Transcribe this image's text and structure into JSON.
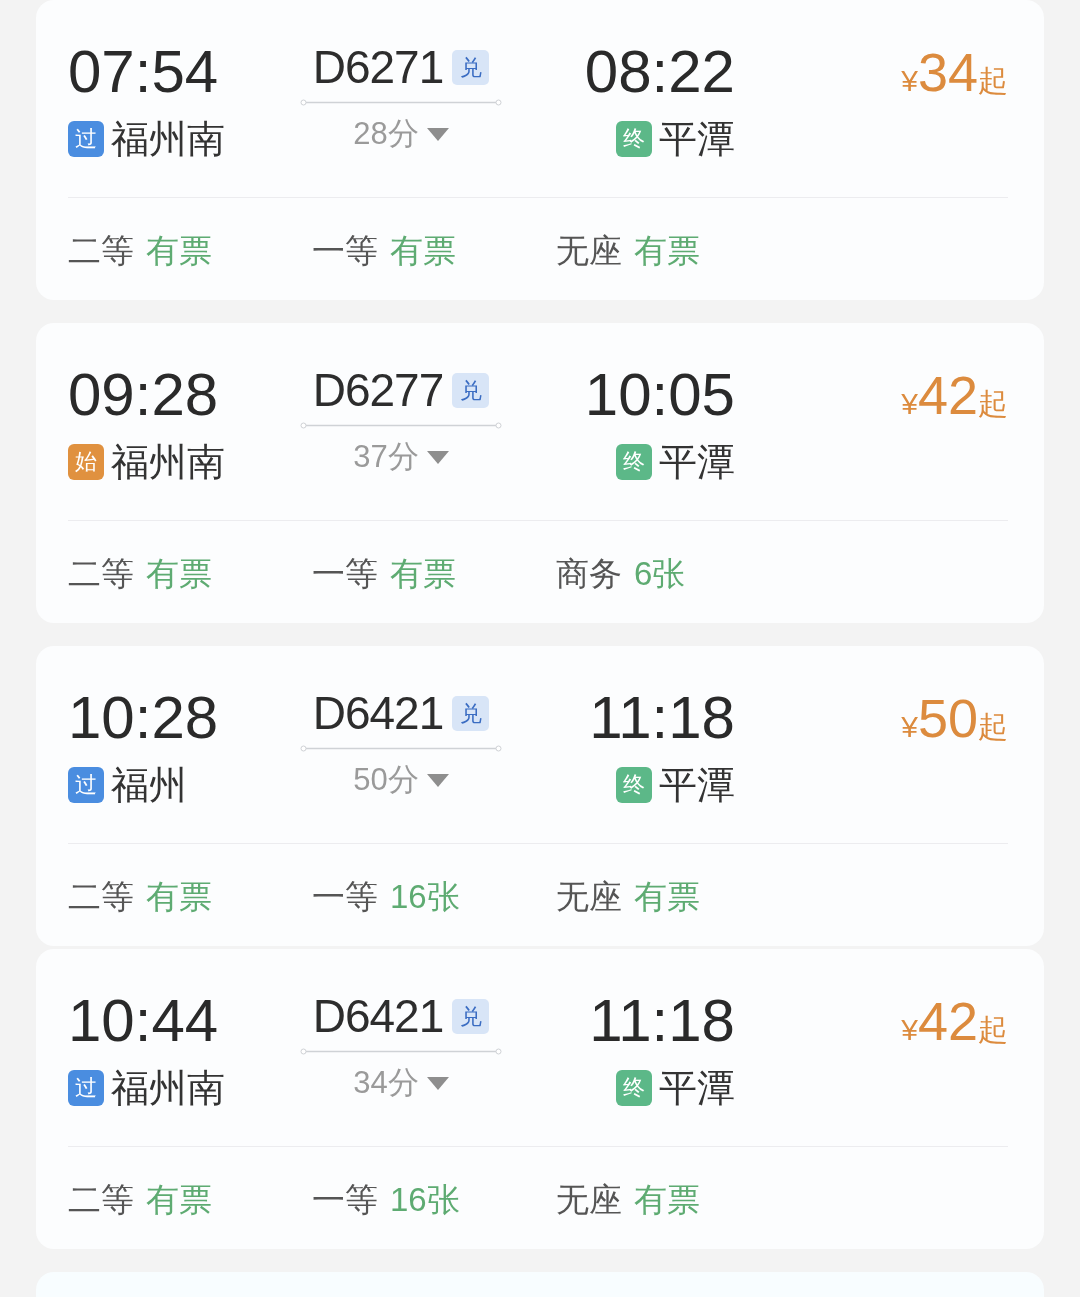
{
  "sections": [
    {
      "trains": [
        {
          "departure": {
            "time": "07:54",
            "tag": {
              "text": "过",
              "color": "#4a8de0"
            },
            "station": "福州南"
          },
          "train_number": "D6271",
          "train_tag": "兑",
          "duration": "28分",
          "arrival": {
            "time": "08:22",
            "tag": {
              "text": "终",
              "color": "#5cb888"
            },
            "station": "平潭"
          },
          "price": {
            "currency": "¥",
            "amount": "34",
            "suffix": "起"
          },
          "seats": [
            {
              "class": "二等",
              "availability": "有票"
            },
            {
              "class": "一等",
              "availability": "有票"
            },
            {
              "class": "无座",
              "availability": "有票"
            }
          ]
        }
      ]
    },
    {
      "trains": [
        {
          "departure": {
            "time": "09:28",
            "tag": {
              "text": "始",
              "color": "#e0913f"
            },
            "station": "福州南"
          },
          "train_number": "D6277",
          "train_tag": "兑",
          "duration": "37分",
          "arrival": {
            "time": "10:05",
            "tag": {
              "text": "终",
              "color": "#5cb888"
            },
            "station": "平潭"
          },
          "price": {
            "currency": "¥",
            "amount": "42",
            "suffix": "起"
          },
          "seats": [
            {
              "class": "二等",
              "availability": "有票"
            },
            {
              "class": "一等",
              "availability": "有票"
            },
            {
              "class": "商务",
              "availability": "6张"
            }
          ]
        }
      ]
    },
    {
      "trains": [
        {
          "departure": {
            "time": "10:28",
            "tag": {
              "text": "过",
              "color": "#4a8de0"
            },
            "station": "福州"
          },
          "train_number": "D6421",
          "train_tag": "兑",
          "duration": "50分",
          "arrival": {
            "time": "11:18",
            "tag": {
              "text": "终",
              "color": "#5cb888"
            },
            "station": "平潭"
          },
          "price": {
            "currency": "¥",
            "amount": "50",
            "suffix": "起"
          },
          "seats": [
            {
              "class": "二等",
              "availability": "有票"
            },
            {
              "class": "一等",
              "availability": "16张"
            },
            {
              "class": "无座",
              "availability": "有票"
            }
          ]
        },
        {
          "departure": {
            "time": "10:44",
            "tag": {
              "text": "过",
              "color": "#4a8de0"
            },
            "station": "福州南"
          },
          "train_number": "D6421",
          "train_tag": "兑",
          "duration": "34分",
          "arrival": {
            "time": "11:18",
            "tag": {
              "text": "终",
              "color": "#5cb888"
            },
            "station": "平潭"
          },
          "price": {
            "currency": "¥",
            "amount": "42",
            "suffix": "起"
          },
          "seats": [
            {
              "class": "二等",
              "availability": "有票"
            },
            {
              "class": "一等",
              "availability": "16张"
            },
            {
              "class": "无座",
              "availability": "有票"
            }
          ]
        }
      ]
    }
  ],
  "more_below": true
}
